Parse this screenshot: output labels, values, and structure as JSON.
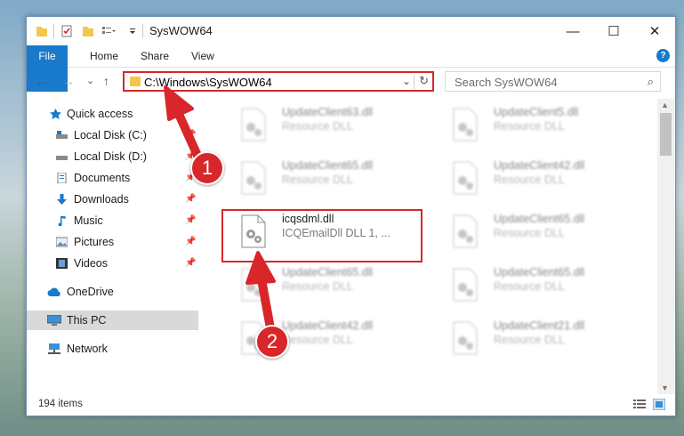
{
  "window": {
    "title": "SysWOW64"
  },
  "titlebar_buttons": {
    "minimize": "—",
    "maximize": "☐",
    "close": "✕"
  },
  "ribbon": {
    "tabs": [
      "File",
      "Home",
      "Share",
      "View"
    ],
    "help": "?"
  },
  "nav": {
    "back": "←",
    "forward": "→",
    "recent": "⌄",
    "up": "↑"
  },
  "address": {
    "path": "C:\\Windows\\SysWOW64",
    "dropdown": "⌄",
    "refresh": "↻"
  },
  "search": {
    "placeholder": "Search SysWOW64",
    "icon": "⌕"
  },
  "sidebar": {
    "items": [
      {
        "label": "Quick access",
        "icon": "star-icon"
      },
      {
        "label": "Local Disk (C:)",
        "icon": "drive-icon"
      },
      {
        "label": "Local Disk (D:)",
        "icon": "drive-icon"
      },
      {
        "label": "Documents",
        "icon": "documents-icon"
      },
      {
        "label": "Downloads",
        "icon": "download-icon"
      },
      {
        "label": "Music",
        "icon": "music-icon"
      },
      {
        "label": "Pictures",
        "icon": "pictures-icon"
      },
      {
        "label": "Videos",
        "icon": "videos-icon"
      },
      {
        "label": "OneDrive",
        "icon": "cloud-icon"
      },
      {
        "label": "This PC",
        "icon": "pc-icon"
      },
      {
        "label": "Network",
        "icon": "network-icon"
      }
    ],
    "pin": "📌"
  },
  "files": [
    {
      "name": "UpdateClient63.dll",
      "desc": "Resource DLL"
    },
    {
      "name": "UpdateClient5.dll",
      "desc": "Resource DLL"
    },
    {
      "name": "UpdateClient65.dll",
      "desc": "Resource DLL"
    },
    {
      "name": "UpdateClient42.dll",
      "desc": "Resource DLL"
    },
    {
      "name": "icqsdml.dll",
      "desc": "ICQEmailDll DLL 1, ..."
    },
    {
      "name": "UpdateClient65.dll",
      "desc": "Resource DLL"
    },
    {
      "name": "UpdateClient65.dll",
      "desc": "Resource DLL"
    },
    {
      "name": "UpdateClient65.dll",
      "desc": "Resource DLL"
    },
    {
      "name": "UpdateClient42.dll",
      "desc": "Resource DLL"
    },
    {
      "name": "UpdateClient21.dll",
      "desc": "Resource DLL"
    }
  ],
  "status": {
    "count": "194 items"
  },
  "callouts": {
    "one": "1",
    "two": "2"
  },
  "colors": {
    "accent": "#1979ca",
    "highlight": "#d9262a",
    "folder": "#f3c64d"
  }
}
